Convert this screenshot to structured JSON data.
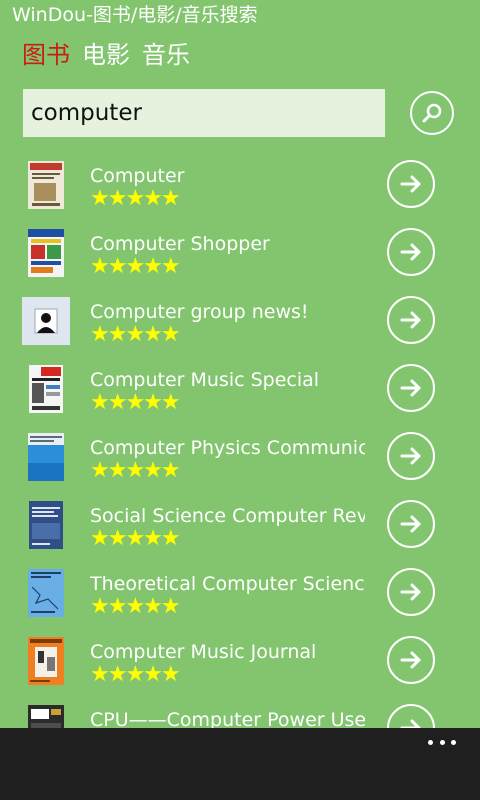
{
  "app": {
    "title": "WinDou-图书/电影/音乐搜索"
  },
  "pivot": [
    {
      "label": "图书",
      "active": true
    },
    {
      "label": "电影",
      "active": false
    },
    {
      "label": "音乐",
      "active": false
    }
  ],
  "search": {
    "value": "computer",
    "button_icon": "search-icon"
  },
  "results": [
    {
      "title": "Computer",
      "rating": 5,
      "stars": "★★★★★",
      "cover_color": "#e9e2d0"
    },
    {
      "title": "Computer Shopper",
      "rating": 5,
      "stars": "★★★★★",
      "cover_color": "#3a6fb5"
    },
    {
      "title": "Computer group news!",
      "rating": 5,
      "stars": "★★★★★",
      "cover_color": "#dfe6ef"
    },
    {
      "title": "Computer Music Special",
      "rating": 5,
      "stars": "★★★★★",
      "cover_color": "#f2f2f2"
    },
    {
      "title": "Computer Physics Communicat",
      "rating": 5,
      "stars": "★★★★★",
      "cover_color": "#2a8fd8"
    },
    {
      "title": "Social Science Computer Review",
      "rating": 5,
      "stars": "★★★★★",
      "cover_color": "#2f4f86"
    },
    {
      "title": "Theoretical Computer Science",
      "rating": 5,
      "stars": "★★★★★",
      "cover_color": "#5aa0e0"
    },
    {
      "title": "Computer Music Journal",
      "rating": 5,
      "stars": "★★★★★",
      "cover_color": "#f07f22"
    },
    {
      "title": "CPU——Computer Power User",
      "rating": 5,
      "stars": "★★★★★",
      "cover_color": "#2b2b2b"
    }
  ],
  "appbar": {
    "more_icon": "ellipsis-icon"
  },
  "colors": {
    "background": "#82c56e",
    "active_pivot": "#cc1d14",
    "stars": "#ffff00",
    "search_box": "#e6f1de",
    "appbar": "#1f1f1f"
  }
}
